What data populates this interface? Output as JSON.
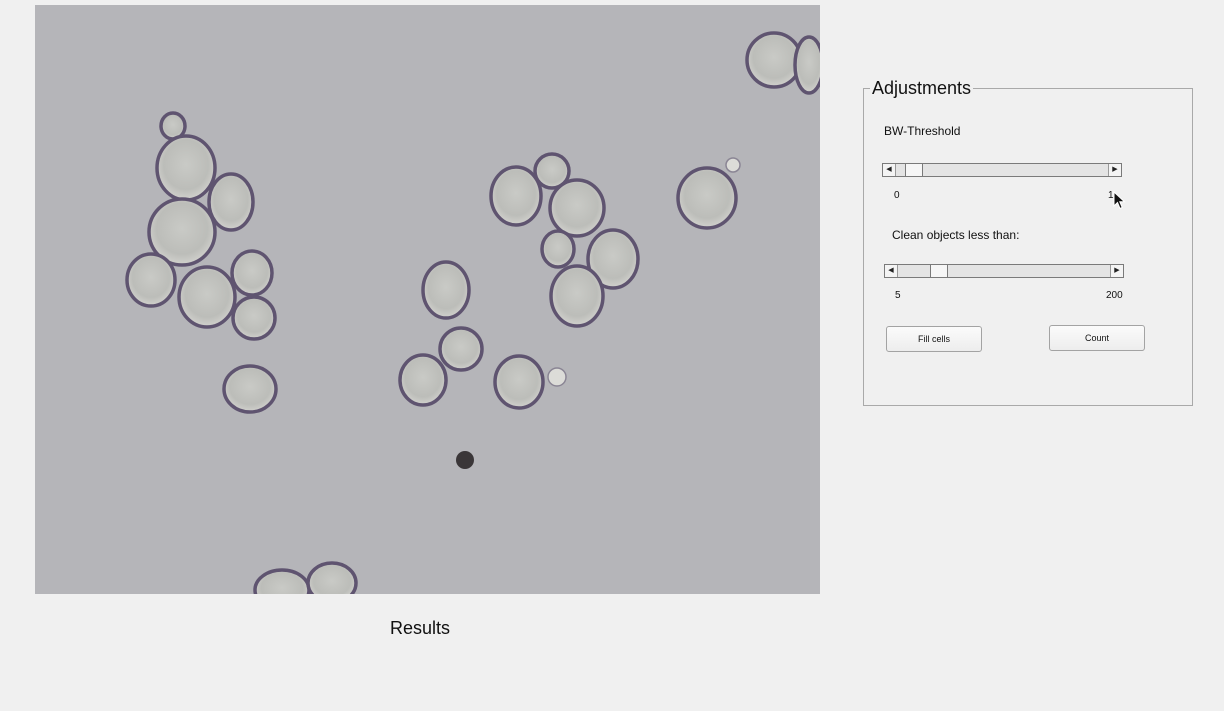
{
  "viewer": {
    "results_label": "Results"
  },
  "adjustments": {
    "title": "Adjustments",
    "bw_threshold": {
      "label": "BW-Threshold",
      "min_label": "0",
      "max_label": "1",
      "value_fraction": 0.05
    },
    "clean_objects": {
      "label": "Clean objects less than:",
      "min_label": "5",
      "max_label": "200",
      "value_fraction": 0.17
    },
    "fill_cells_button": "Fill cells",
    "count_button": "Count"
  }
}
